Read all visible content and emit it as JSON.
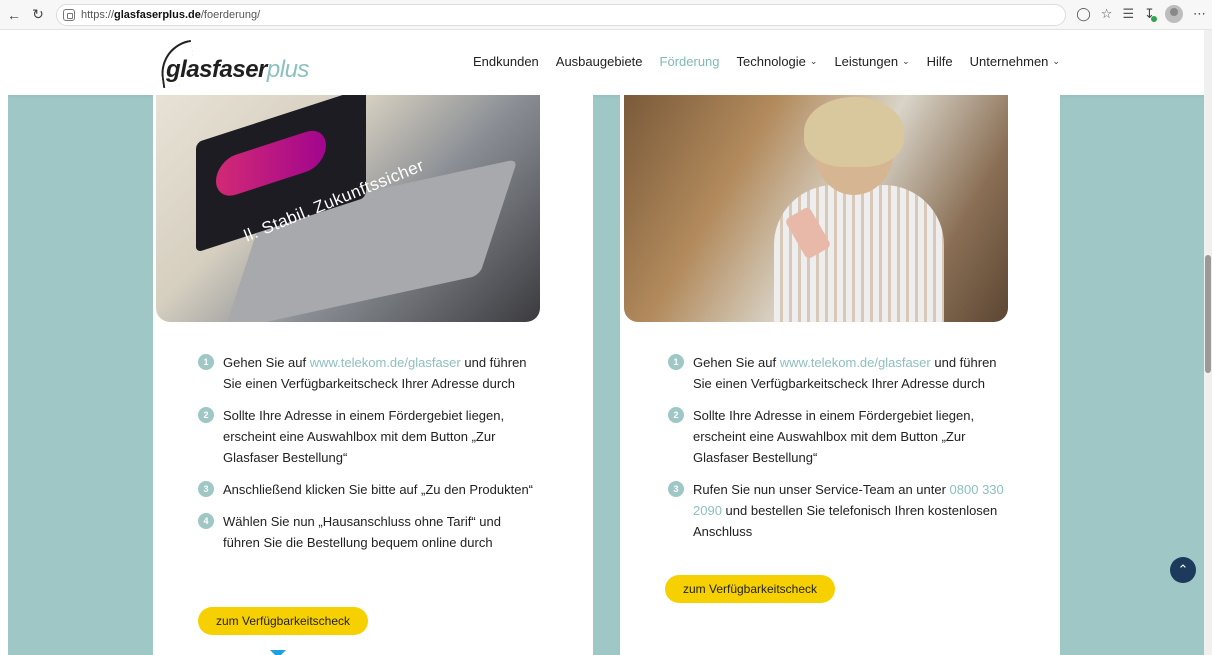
{
  "browser": {
    "url_prefix": "https://",
    "url_host": "glasfaserplus.de",
    "url_path": "/foerderung/"
  },
  "brand": {
    "logo_part1": "glasfaser",
    "logo_part2": "plus"
  },
  "nav": {
    "items": [
      {
        "label": "Endkunden",
        "has_dropdown": false,
        "active": false
      },
      {
        "label": "Ausbaugebiete",
        "has_dropdown": false,
        "active": false
      },
      {
        "label": "Förderung",
        "has_dropdown": false,
        "active": true
      },
      {
        "label": "Technologie",
        "has_dropdown": true,
        "active": false
      },
      {
        "label": "Leistungen",
        "has_dropdown": true,
        "active": false
      },
      {
        "label": "Hilfe",
        "has_dropdown": false,
        "active": false
      },
      {
        "label": "Unternehmen",
        "has_dropdown": true,
        "active": false
      }
    ]
  },
  "left_card": {
    "photo_caption": "ll. Stabil. Zukunftssicher",
    "steps": [
      {
        "num": "1",
        "pre": "Gehen Sie auf ",
        "link": "www.telekom.de/glasfaser",
        "post": " und führen Sie einen Verfügbarkeitscheck Ihrer Adresse durch"
      },
      {
        "num": "2",
        "pre": "Sollte Ihre Adresse in einem Fördergebiet liegen, erscheint eine Auswahlbox mit dem Button „Zur Glasfaser Bestellung“",
        "link": "",
        "post": ""
      },
      {
        "num": "3",
        "pre": "Anschließend klicken Sie bitte auf „Zu den Produkten“",
        "link": "",
        "post": ""
      },
      {
        "num": "4",
        "pre": "Wählen Sie nun „Hausanschluss ohne Tarif“ und führen Sie die Bestellung bequem online durch",
        "link": "",
        "post": ""
      }
    ],
    "cta": "zum Verfügbarkeitscheck"
  },
  "right_card": {
    "steps": [
      {
        "num": "1",
        "pre": "Gehen Sie auf ",
        "link": "www.telekom.de/glasfaser",
        "post": " und führen Sie einen Verfügbarkeitscheck Ihrer Adresse durch"
      },
      {
        "num": "2",
        "pre": "Sollte Ihre Adresse in einem Fördergebiet liegen, erscheint eine Auswahlbox mit dem Button „Zur Glasfaser Bestellung“",
        "link": "",
        "post": ""
      },
      {
        "num": "3",
        "pre": "Rufen Sie nun unser Service-Team an unter ",
        "link": "0800 330 2090",
        "post": " und bestellen Sie telefonisch Ihren kostenlosen Anschluss"
      }
    ],
    "cta": "zum Verfügbarkeitscheck"
  },
  "colors": {
    "teal": "#9ec7c6",
    "link": "#8cc0bf",
    "cta": "#f7d000",
    "scroll_top": "#1b3a5c"
  }
}
